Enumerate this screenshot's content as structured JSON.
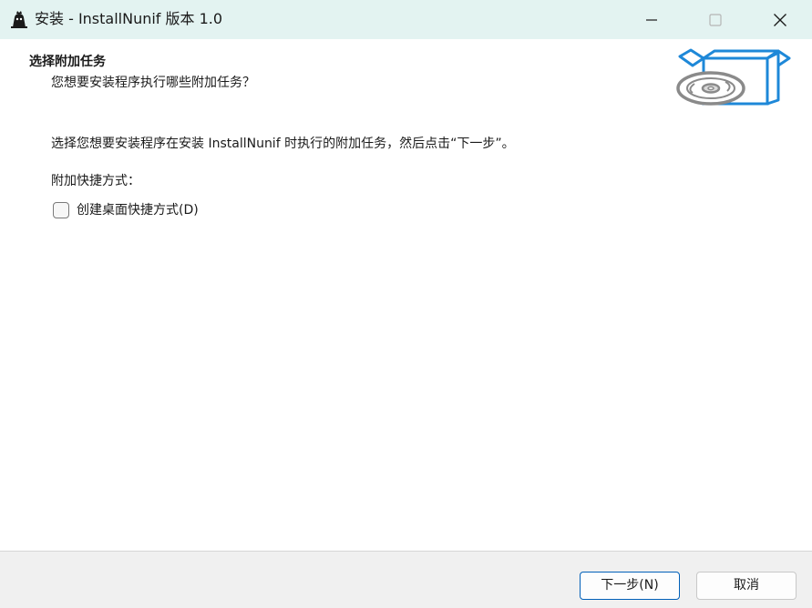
{
  "window": {
    "title": "安装 - InstallNunif 版本 1.0"
  },
  "header": {
    "title": "选择附加任务",
    "subtitle": "您想要安装程序执行哪些附加任务？"
  },
  "body": {
    "instruction": "选择您想要安装程序在安装 InstallNunif 时执行的附加任务，然后点击“下一步”。",
    "group_label": "附加快捷方式：",
    "checkbox": {
      "label": "创建桌面快捷方式(D)",
      "checked": false
    }
  },
  "footer": {
    "next_label": "下一步(N)",
    "cancel_label": "取消"
  },
  "icons": {
    "app": "installer-app-icon",
    "minimize": "minimize-icon",
    "maximize": "maximize-icon",
    "close": "close-icon",
    "header_image": "box-with-disc-icon"
  },
  "colors": {
    "titlebar_bg": "#e3f3f1",
    "accent": "#005fb8",
    "box_blue": "#1e88d8",
    "disc_gray": "#8a8a8a",
    "footer_bg": "#f0f0f0"
  }
}
